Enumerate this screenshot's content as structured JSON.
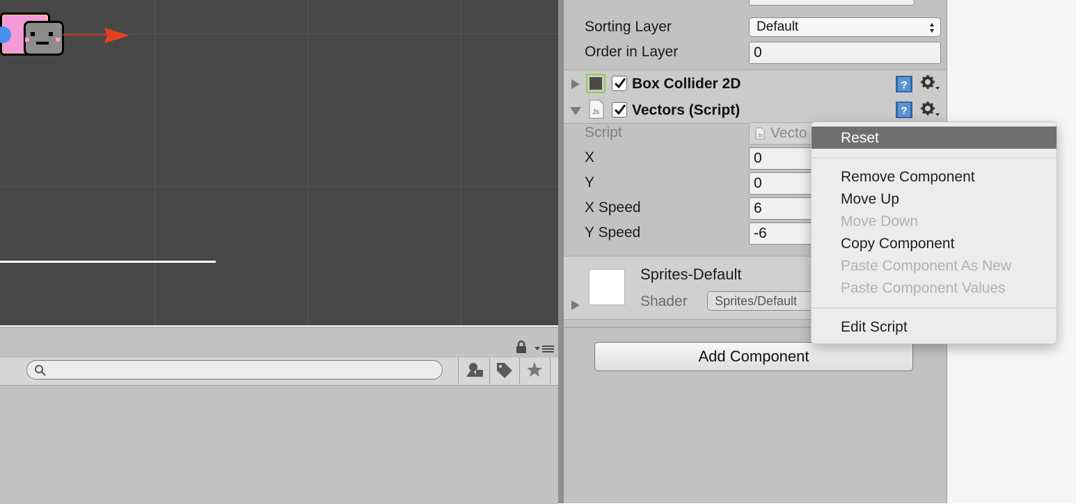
{
  "inspector": {
    "sorting_layer_label": "Sorting Layer",
    "sorting_layer_value": "Default",
    "order_in_layer_label": "Order in Layer",
    "order_in_layer_value": "0",
    "box_collider": {
      "title": "Box Collider 2D",
      "enabled": true
    },
    "vectors": {
      "title": "Vectors (Script)",
      "enabled": true,
      "script_label": "Script",
      "script_value": "Vecto",
      "x_label": "X",
      "x_value": "0",
      "y_label": "Y",
      "y_value": "0",
      "x_speed_label": "X Speed",
      "x_speed_value": "6",
      "y_speed_label": "Y Speed",
      "y_speed_value": "-6"
    },
    "material": {
      "name": "Sprites-Default",
      "shader_label": "Shader",
      "shader_value": "Sprites/Default"
    },
    "add_component_label": "Add Component"
  },
  "context_menu": {
    "items": [
      {
        "label": "Reset",
        "enabled": true,
        "highlighted": true
      },
      {
        "label": "Remove Component",
        "enabled": true
      },
      {
        "label": "Move Up",
        "enabled": true
      },
      {
        "label": "Move Down",
        "enabled": false
      },
      {
        "label": "Copy Component",
        "enabled": true
      },
      {
        "label": "Paste Component As New",
        "enabled": false
      },
      {
        "label": "Paste Component Values",
        "enabled": false
      },
      {
        "label": "Edit Script",
        "enabled": true
      }
    ]
  },
  "icons": {
    "help": "help-book-icon",
    "gear": "gear-icon",
    "js": "javascript-file-icon",
    "search": "search-icon",
    "lock": "lock-icon"
  },
  "colors": {
    "scene_bg": "#484848",
    "panel_bg": "#c2c2c2",
    "menu_highlight": "#6f6f6f",
    "gizmo_arrow": "#e8401c"
  }
}
